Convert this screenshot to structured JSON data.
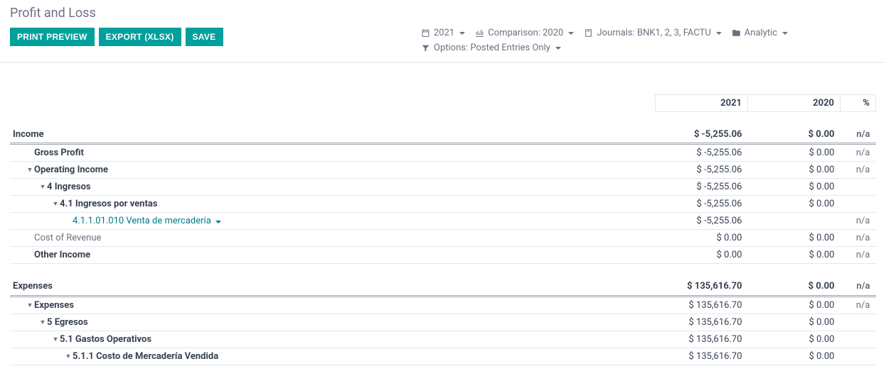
{
  "title": "Profit and Loss",
  "toolbar": {
    "print": "PRINT PREVIEW",
    "export": "EXPORT (XLSX)",
    "save": "SAVE"
  },
  "filters": {
    "year": "2021",
    "comparison": "Comparison: 2020",
    "journals": "Journals: BNK1, 2, 3, FACTU",
    "analytic": "Analytic",
    "options": "Options: Posted Entries Only"
  },
  "columns": {
    "c1": "2021",
    "c2": "2020",
    "c3": "%"
  },
  "rows": [
    {
      "section": true,
      "label": "Income",
      "v1": "$ -5,255.06",
      "v2": "$ 0.00",
      "pct": "n/a"
    },
    {
      "indent": 1,
      "bold": true,
      "label": "Gross Profit",
      "v1": "$ -5,255.06",
      "v2": "$ 0.00",
      "pct": "n/a"
    },
    {
      "indent": 1,
      "caret": true,
      "bold": true,
      "label": "Operating Income",
      "v1": "$ -5,255.06",
      "v2": "$ 0.00",
      "pct": "n/a"
    },
    {
      "indent": 2,
      "caret": true,
      "bold": true,
      "label": "4 Ingresos",
      "v1": "$ -5,255.06",
      "v2": "$ 0.00",
      "pct": ""
    },
    {
      "indent": 3,
      "caret": true,
      "bold": true,
      "label": "4.1 Ingresos por ventas",
      "v1": "$ -5,255.06",
      "v2": "$ 0.00",
      "pct": ""
    },
    {
      "indent": 4,
      "teal": true,
      "tealCaret": true,
      "label": "4.1.1.01.010 Venta de mercadería",
      "v1": "$ -5,255.06",
      "v2": "",
      "pct": "n/a"
    },
    {
      "indent": 1,
      "gray": true,
      "label": "Cost of Revenue",
      "v1": "$ 0.00",
      "v2": "$ 0.00",
      "pct": "n/a"
    },
    {
      "indent": 1,
      "bold": true,
      "label": "Other Income",
      "v1": "$ 0.00",
      "v2": "$ 0.00",
      "pct": "n/a"
    },
    {
      "section": true,
      "label": "Expenses",
      "v1": "$ 135,616.70",
      "v2": "$ 0.00",
      "pct": "n/a"
    },
    {
      "indent": 1,
      "caret": true,
      "bold": true,
      "label": "Expenses",
      "v1": "$ 135,616.70",
      "v2": "$ 0.00",
      "pct": "n/a"
    },
    {
      "indent": 2,
      "caret": true,
      "bold": true,
      "label": "5 Egresos",
      "v1": "$ 135,616.70",
      "v2": "$ 0.00",
      "pct": ""
    },
    {
      "indent": 3,
      "caret": true,
      "bold": true,
      "label": "5.1 Gastos Operativos",
      "v1": "$ 135,616.70",
      "v2": "$ 0.00",
      "pct": ""
    },
    {
      "indent": 4,
      "caret": true,
      "bold": true,
      "label": "5.1.1 Costo de Mercadería Vendida",
      "v1": "$ 135,616.70",
      "v2": "$ 0.00",
      "pct": ""
    }
  ]
}
